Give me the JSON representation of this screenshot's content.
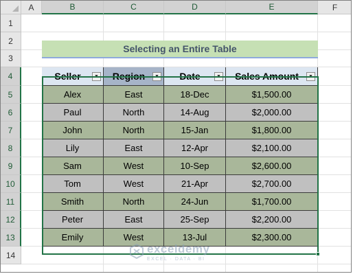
{
  "sheet": {
    "columns": [
      "A",
      "B",
      "C",
      "D",
      "E",
      "F"
    ],
    "rows": [
      "1",
      "2",
      "3",
      "4",
      "5",
      "6",
      "7",
      "8",
      "9",
      "10",
      "11",
      "12",
      "13",
      "14"
    ],
    "title": "Selecting an Entire Table"
  },
  "table": {
    "headers": [
      "Seller",
      "Region",
      "Date",
      "Sales Amount"
    ],
    "rows": [
      [
        "Alex",
        "East",
        "18-Dec",
        "$1,500.00"
      ],
      [
        "Paul",
        "North",
        "14-Aug",
        "$2,000.00"
      ],
      [
        "John",
        "North",
        "15-Jan",
        "$1,800.00"
      ],
      [
        "Lily",
        "East",
        "12-Apr",
        "$2,100.00"
      ],
      [
        "Sam",
        "West",
        "10-Sep",
        "$2,600.00"
      ],
      [
        "Tom",
        "West",
        "21-Apr",
        "$2,700.00"
      ],
      [
        "Smith",
        "North",
        "24-Jun",
        "$1,700.00"
      ],
      [
        "Peter",
        "East",
        "25-Sep",
        "$2,200.00"
      ],
      [
        "Emily",
        "West",
        "13-Jul",
        "$2,300.00"
      ]
    ]
  },
  "watermark": {
    "name": "exceldemy",
    "tagline": "EXCEL · DATA · BI"
  },
  "colors": {
    "accent": "#217346",
    "title_fill": "#c6e0b4",
    "header_fill": "#dce6f1",
    "header_selected_fill": "#a6b4c8",
    "body_fill_a": "#a9b79a",
    "body_fill_b": "#c0c0c0"
  },
  "icons": [
    "filter-dropdown-icon",
    "select-all-icon",
    "fill-handle-icon",
    "exceldemy-logo-icon"
  ]
}
